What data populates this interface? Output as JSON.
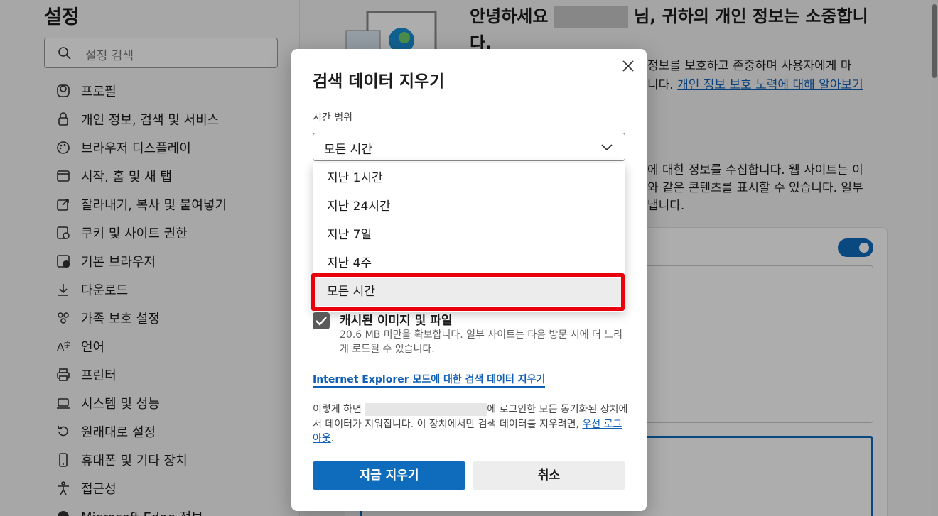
{
  "sidebar": {
    "title": "설정",
    "search_placeholder": "설정 검색",
    "items": [
      {
        "label": "프로필",
        "icon": "profile-icon"
      },
      {
        "label": "개인 정보, 검색 및 서비스",
        "icon": "lock-icon"
      },
      {
        "label": "브라우저 디스플레이",
        "icon": "palette-icon"
      },
      {
        "label": "시작, 홈 및 새 탭",
        "icon": "home-tab-icon"
      },
      {
        "label": "잘라내기, 복사 및 붙여넣기",
        "icon": "share-icon"
      },
      {
        "label": "쿠키 및 사이트 권한",
        "icon": "site-permissions-icon"
      },
      {
        "label": "기본 브라우저",
        "icon": "default-browser-icon"
      },
      {
        "label": "다운로드",
        "icon": "download-icon"
      },
      {
        "label": "가족 보호 설정",
        "icon": "family-icon"
      },
      {
        "label": "언어",
        "icon": "language-icon"
      },
      {
        "label": "프린터",
        "icon": "printer-icon"
      },
      {
        "label": "시스템 및 성능",
        "icon": "laptop-icon"
      },
      {
        "label": "원래대로 설정",
        "icon": "reset-icon"
      },
      {
        "label": "휴대폰 및 기타 장치",
        "icon": "phone-icon"
      },
      {
        "label": "접근성",
        "icon": "accessibility-icon"
      },
      {
        "label": "Microsoft Edge 정보",
        "icon": "edge-icon"
      }
    ]
  },
  "main": {
    "hero_title_prefix": "안녕하세요",
    "hero_title_suffix": "님, 귀하의 개인 정보는 소중합니다.",
    "hero_desc": "정보를 보호하고 존중하며 사용자에게 마",
    "hero_desc_2": "니다.",
    "hero_link": "개인 정보 보호 노력에 대해 알아보기",
    "para2_line1": "에 대한 정보를 수집합니다. 웹 사이트는 이",
    "para2_line2": "와 같은 콘텐츠를 표시할 수 있습니다. 일부",
    "para2_line3": "냅니다."
  },
  "dialog": {
    "title": "검색 데이터 지우기",
    "time_range_label": "시간 범위",
    "time_range_value": "모든 시간",
    "options": [
      "지난 1시간",
      "지난 24시간",
      "지난 7일",
      "지난 4주",
      "모든 시간"
    ],
    "selected_option_index": 4,
    "cached_label": "캐시된 이미지 및 파일",
    "cached_desc": "20.6 MB 미만을 확보합니다. 일부 사이트는 다음 방문 시에 더 느리게 로드될 수 있습니다.",
    "ie_link": "Internet Explorer 모드에 대한 검색 데이터 지우기",
    "note_prefix": "이렇게 하면",
    "note_mid": "에 로그인한 모든 동기화된 장치에서 데이터가 지워집니다. 이 장치에서만 검색 데이터를 지우려면,",
    "note_link": "우선 로그아웃",
    "note_end": ".",
    "clear_button": "지금 지우기",
    "cancel_button": "취소"
  },
  "colors": {
    "accent": "#0f6cbd",
    "highlight_border": "#e8000b",
    "link": "#0f5fb6"
  }
}
